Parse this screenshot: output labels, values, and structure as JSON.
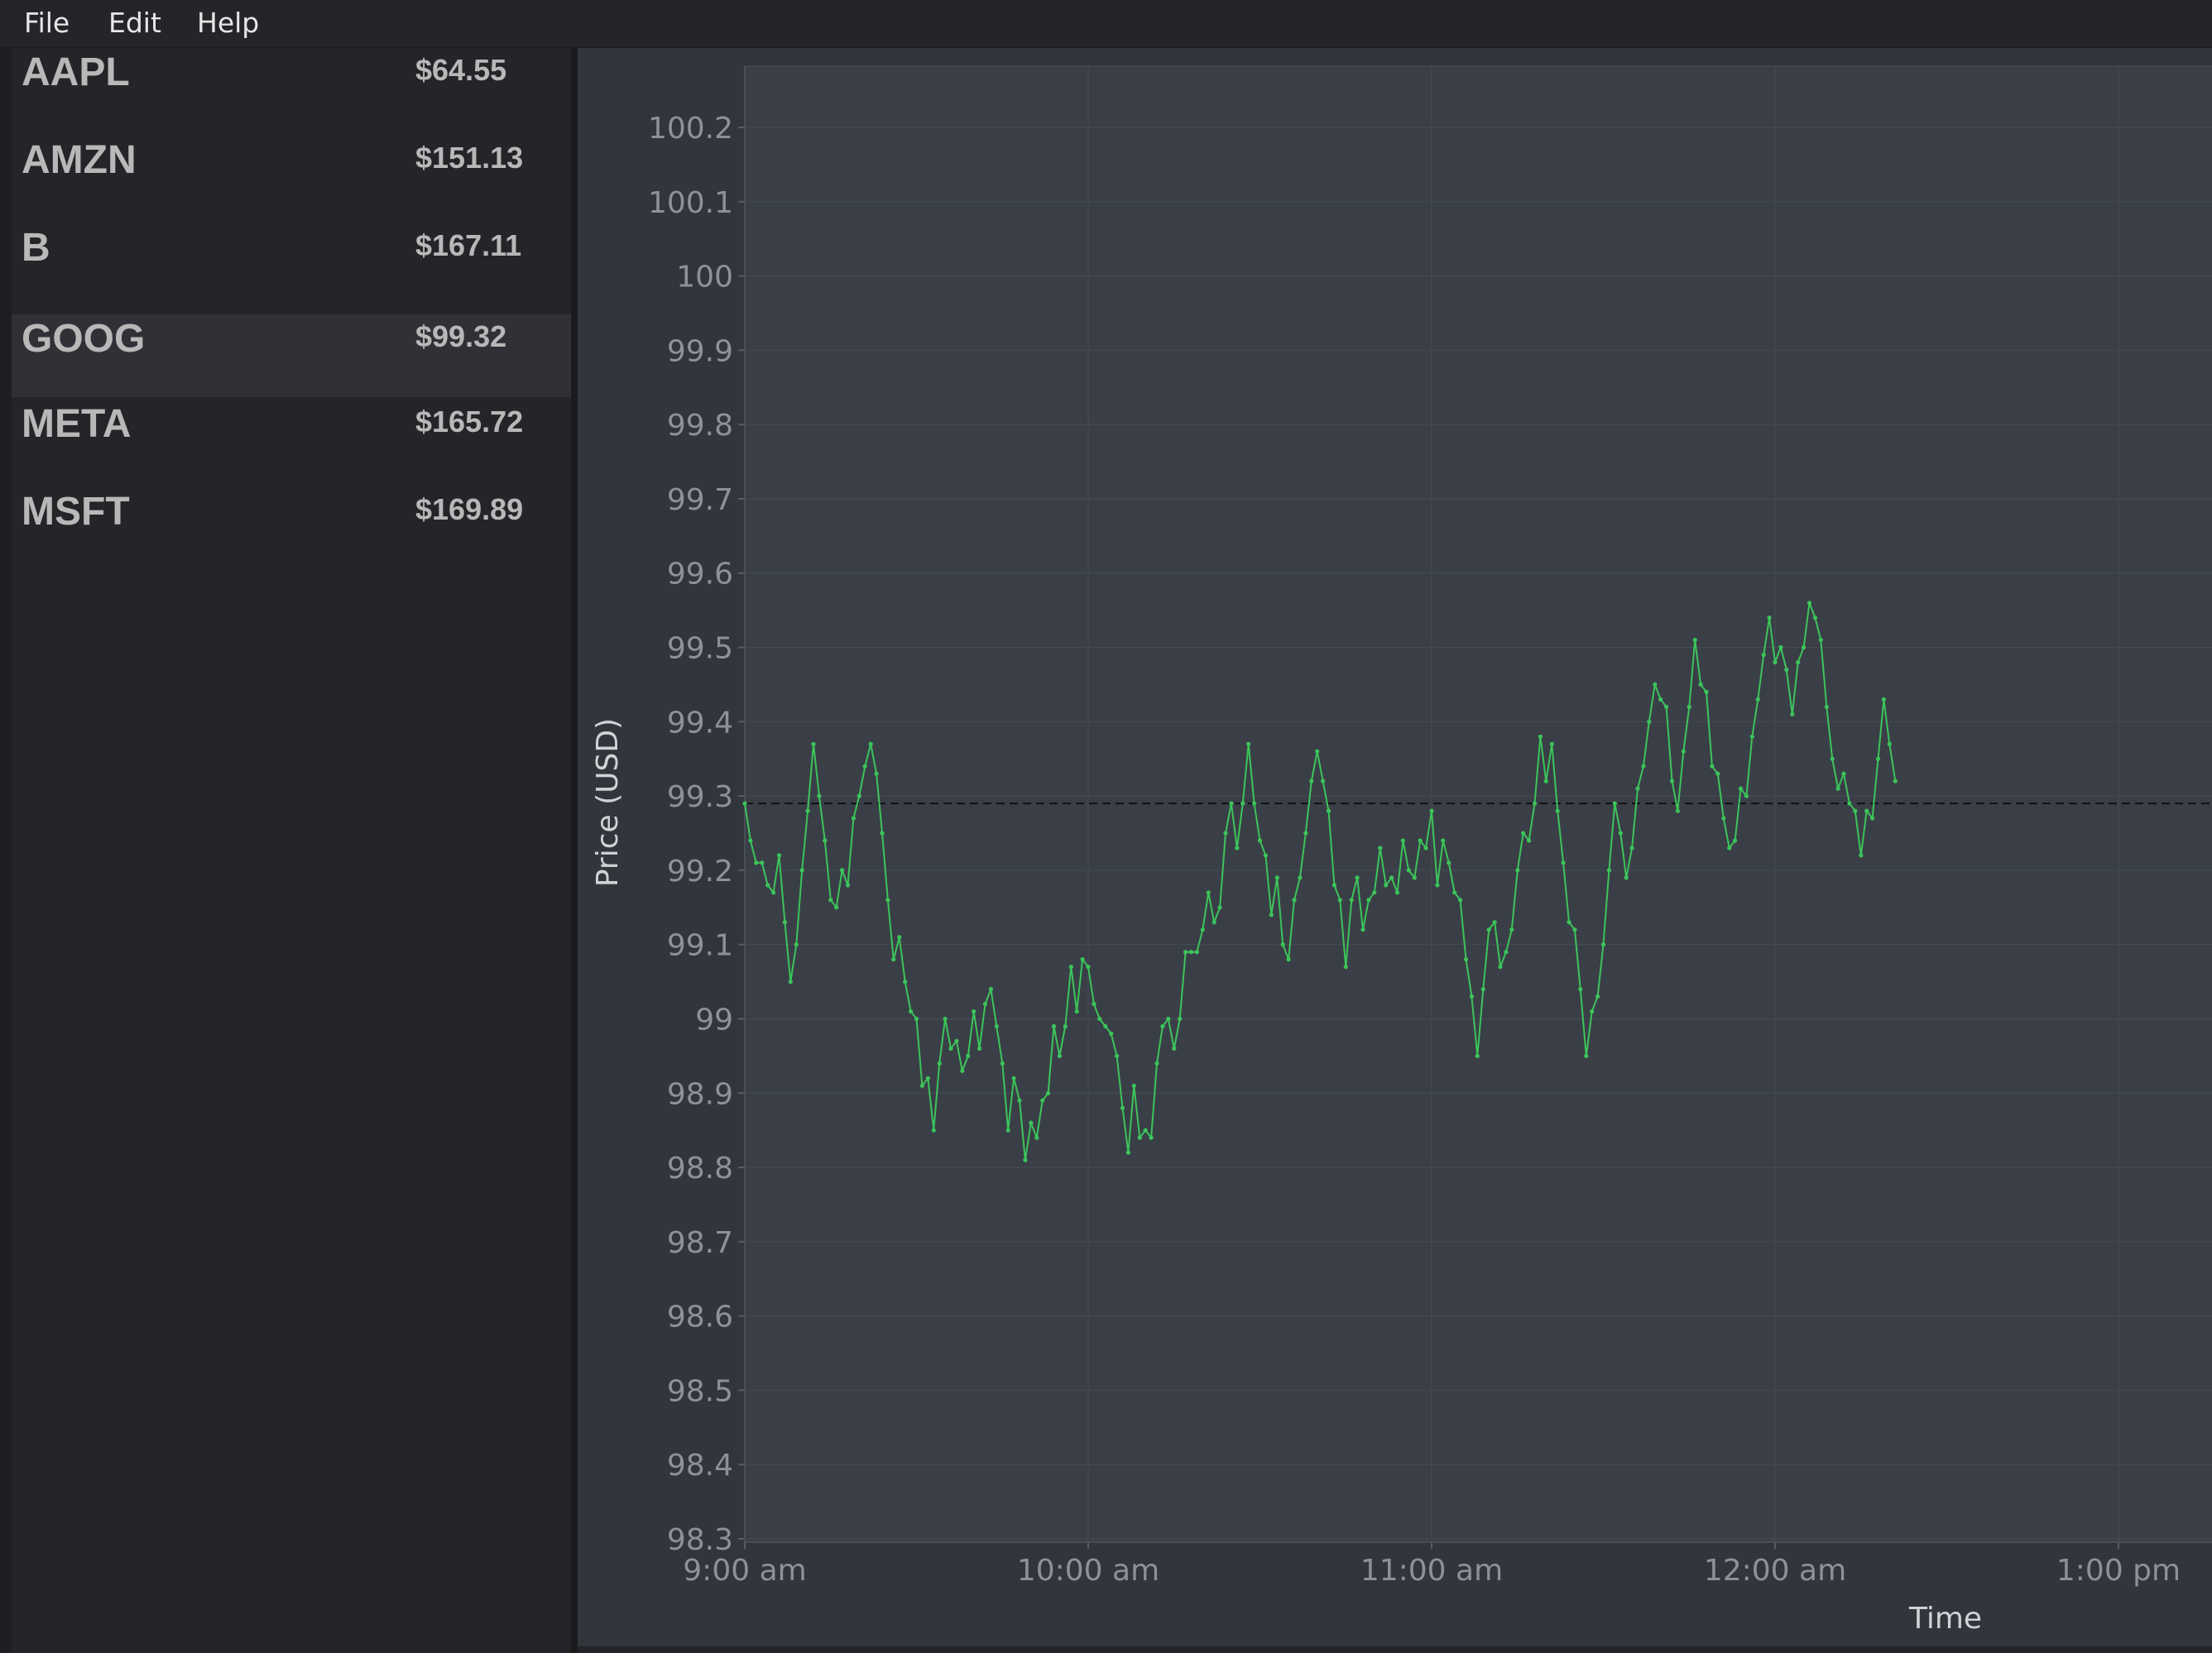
{
  "menu": [
    {
      "label": "File"
    },
    {
      "label": "Edit"
    },
    {
      "label": "Help"
    }
  ],
  "tickers": [
    {
      "symbol": "AAPL",
      "price": "$64.55"
    },
    {
      "symbol": "AMZN",
      "price": "$151.13"
    },
    {
      "symbol": "B",
      "price": "$167.11"
    },
    {
      "symbol": "GOOG",
      "price": "$99.32",
      "selected": true
    },
    {
      "symbol": "META",
      "price": "$165.72"
    },
    {
      "symbol": "MSFT",
      "price": "$169.89"
    }
  ],
  "colors": {
    "line": "#3cc45a",
    "plot_bg": "#3a3f47",
    "panel_bg": "#32353b",
    "axis_text": "#8e9196",
    "reference_line": "#111111"
  },
  "chart_data": {
    "type": "line",
    "title": "",
    "xlabel": "Time",
    "ylabel": "Price (USD)",
    "ylim": [
      98.3,
      100.2
    ],
    "y_ticks": [
      100.2,
      100.1,
      100,
      99.9,
      99.8,
      99.7,
      99.6,
      99.5,
      99.4,
      99.3,
      99.2,
      99.1,
      99,
      98.9,
      98.8,
      98.7,
      98.6,
      98.5,
      98.4,
      98.3
    ],
    "x_ticks": [
      "9:00 am",
      "10:00 am",
      "11:00 am",
      "12:00 am",
      "1:00 pm"
    ],
    "xlim_minutes_after_9am": [
      0,
      255
    ],
    "grid": true,
    "reference_line": 99.29,
    "sample_interval_minutes": 1,
    "series": [
      {
        "values": [
          99.29,
          99.24,
          99.21,
          99.21,
          99.18,
          99.17,
          99.22,
          99.13,
          99.05,
          99.1,
          99.2,
          99.28,
          99.37,
          99.3,
          99.24,
          99.16,
          99.15,
          99.2,
          99.18,
          99.27,
          99.3,
          99.34,
          99.37,
          99.33,
          99.25,
          99.16,
          99.08,
          99.11,
          99.05,
          99.01,
          99.0,
          98.91,
          98.92,
          98.85,
          98.94,
          99.0,
          98.96,
          98.97,
          98.93,
          98.95,
          99.01,
          98.96,
          99.02,
          99.04,
          98.99,
          98.94,
          98.85,
          98.92,
          98.89,
          98.81,
          98.86,
          98.84,
          98.89,
          98.9,
          98.99,
          98.95,
          98.99,
          99.07,
          99.01,
          99.08,
          99.07,
          99.02,
          99.0,
          98.99,
          98.98,
          98.95,
          98.88,
          98.82,
          98.91,
          98.84,
          98.85,
          98.84,
          98.94,
          98.99,
          99.0,
          98.96,
          99.0,
          99.09,
          99.09,
          99.09,
          99.12,
          99.17,
          99.13,
          99.15,
          99.25,
          99.29,
          99.23,
          99.29,
          99.37,
          99.29,
          99.24,
          99.22,
          99.14,
          99.19,
          99.1,
          99.08,
          99.16,
          99.19,
          99.25,
          99.32,
          99.36,
          99.32,
          99.28,
          99.18,
          99.16,
          99.07,
          99.16,
          99.19,
          99.12,
          99.16,
          99.17,
          99.23,
          99.18,
          99.19,
          99.17,
          99.24,
          99.2,
          99.19,
          99.24,
          99.23,
          99.28,
          99.18,
          99.24,
          99.21,
          99.17,
          99.16,
          99.08,
          99.03,
          98.95,
          99.04,
          99.12,
          99.13,
          99.07,
          99.09,
          99.12,
          99.2,
          99.25,
          99.24,
          99.29,
          99.38,
          99.32,
          99.37,
          99.28,
          99.21,
          99.13,
          99.12,
          99.04,
          98.95,
          99.01,
          99.03,
          99.1,
          99.2,
          99.29,
          99.25,
          99.19,
          99.23,
          99.31,
          99.34,
          99.4,
          99.45,
          99.43,
          99.42,
          99.32,
          99.28,
          99.36,
          99.42,
          99.51,
          99.45,
          99.44,
          99.34,
          99.33,
          99.27,
          99.23,
          99.24,
          99.31,
          99.3,
          99.38,
          99.43,
          99.49,
          99.54,
          99.48,
          99.5,
          99.47,
          99.41,
          99.48,
          99.5,
          99.56,
          99.54,
          99.51,
          99.42,
          99.35,
          99.31,
          99.33,
          99.29,
          99.28,
          99.22,
          99.28,
          99.27,
          99.35,
          99.43,
          99.37,
          99.32
        ]
      }
    ]
  }
}
